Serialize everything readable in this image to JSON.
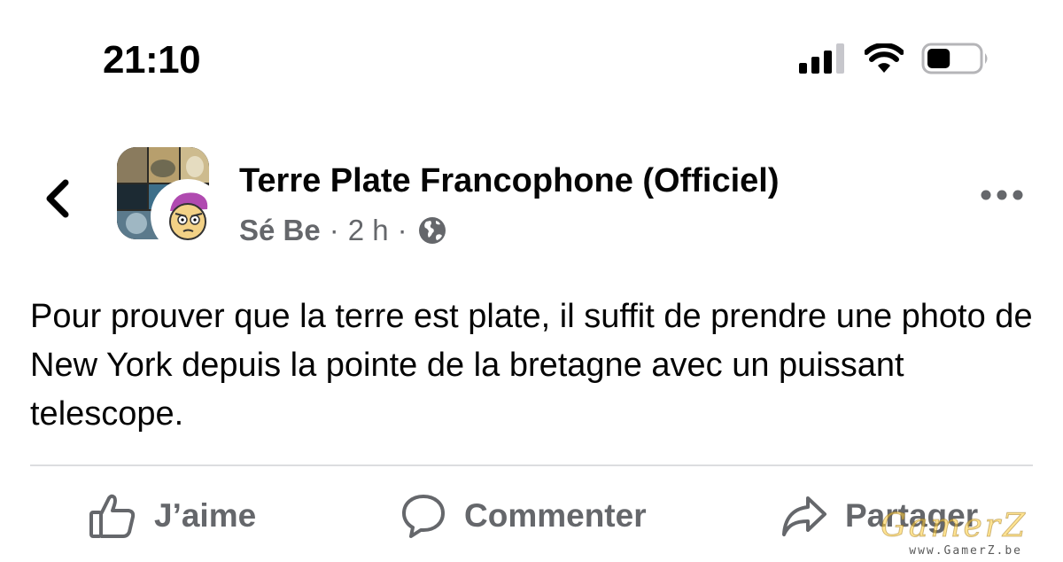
{
  "status_bar": {
    "time": "21:10",
    "icons": [
      "cellular-signal-icon",
      "wifi-icon",
      "battery-icon"
    ],
    "battery_level": 0.45
  },
  "post": {
    "page_name": "Terre Plate Francophone (Officiel)",
    "author": "Sé Be",
    "separator": "·",
    "time_ago": "2 h",
    "audience_icon": "globe-icon",
    "text": "Pour prouver que la terre est plate, il suffit de prendre une photo de New York depuis la pointe de la bretagne avec un puissant telescope."
  },
  "actions": {
    "like_label": "J’aime",
    "comment_label": "Commenter",
    "share_label": "Partager"
  },
  "watermark": {
    "logo": "GamerZ",
    "url": "www.GamerZ.be"
  },
  "colors": {
    "text_primary": "#050505",
    "text_secondary": "#65676b",
    "divider": "#dcdde0",
    "background": "#ffffff"
  }
}
